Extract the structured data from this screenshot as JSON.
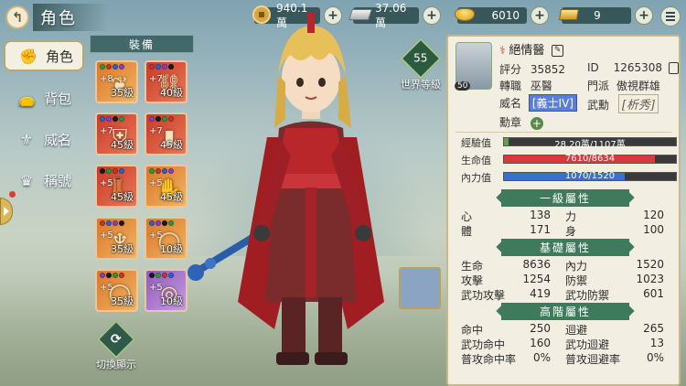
{
  "header": {
    "title": "角色",
    "resources": [
      {
        "icon": "copper-coin-icon",
        "value": "940.1萬"
      },
      {
        "icon": "silver-bar-icon",
        "value": "37.06萬"
      },
      {
        "icon": "gold-ingot-icon",
        "value": "6010"
      },
      {
        "icon": "gold-bar-icon",
        "value": "9"
      }
    ]
  },
  "nav": {
    "items": [
      {
        "label": "角色",
        "icon": "fist-icon",
        "active": true
      },
      {
        "label": "背包",
        "icon": "bag-icon",
        "active": false
      },
      {
        "label": "威名",
        "icon": "crest-icon",
        "active": false
      },
      {
        "label": "稱號",
        "icon": "title-badge-icon",
        "active": false
      }
    ]
  },
  "equipment": {
    "title": "裝備",
    "slots": [
      {
        "plus": "+8",
        "level": "35級",
        "rarity": "orange",
        "item": "necklace-icon"
      },
      {
        "plus": "+7",
        "level": "40級",
        "rarity": "red",
        "item": "wrist-guard-icon"
      },
      {
        "plus": "+7",
        "level": "45級",
        "rarity": "red",
        "item": "armor-icon"
      },
      {
        "plus": "+7",
        "level": "45級",
        "rarity": "red",
        "item": "bracer-icon"
      },
      {
        "plus": "+5",
        "level": "45級",
        "rarity": "red",
        "item": "boots-icon"
      },
      {
        "plus": "+5",
        "level": "45級",
        "rarity": "orange",
        "item": "gloves-icon"
      },
      {
        "plus": "+5",
        "level": "35級",
        "rarity": "orange",
        "item": "pendant-icon"
      },
      {
        "plus": "+5",
        "level": "10級",
        "rarity": "orange",
        "item": "ring-icon"
      },
      {
        "plus": "+5",
        "level": "35級",
        "rarity": "orange",
        "item": "ring-icon"
      },
      {
        "plus": "+5",
        "level": "10級",
        "rarity": "purple",
        "item": "jade-pendant-icon"
      }
    ],
    "swap_label": "切換顯示"
  },
  "world_level": {
    "value": "55",
    "label": "世界等級"
  },
  "profile": {
    "avatar_level": "50",
    "name": "絕情醫",
    "score_label": "評分",
    "score": "35852",
    "id_label": "ID",
    "id": "1265308",
    "job_label": "轉職",
    "job": "巫醫",
    "sect_label": "門派",
    "sect": "傲視群雄",
    "fame_label": "威名",
    "fame": "[義士IV]",
    "martial_label": "武勳",
    "martial": "[析秀]",
    "medal_label": "勳章"
  },
  "bars": [
    {
      "label": "經驗值",
      "text": "28.20萬/1107萬",
      "fraction": 0.025,
      "color": "#5ea04a"
    },
    {
      "label": "生命值",
      "text": "7610/8634",
      "fraction": 0.88,
      "color": "#d83a3a"
    },
    {
      "label": "內力值",
      "text": "1070/1520",
      "fraction": 0.7,
      "color": "#3a6fd0"
    }
  ],
  "sections": {
    "primary": {
      "title": "一級屬性",
      "stats": [
        [
          "心",
          "138",
          "力",
          "120"
        ],
        [
          "體",
          "171",
          "身",
          "100"
        ]
      ]
    },
    "base": {
      "title": "基礎屬性",
      "stats": [
        [
          "生命",
          "8636",
          "內力",
          "1520"
        ],
        [
          "攻擊",
          "1254",
          "防禦",
          "1023"
        ],
        [
          "武功攻擊",
          "419",
          "武功防禦",
          "601"
        ]
      ]
    },
    "advanced": {
      "title": "高階屬性",
      "stats": [
        [
          "命中",
          "250",
          "迴避",
          "265"
        ],
        [
          "武功命中",
          "160",
          "武功迴避",
          "13"
        ],
        [
          "普攻命中率",
          "0%",
          "普攻迴避率",
          "0%"
        ]
      ]
    }
  }
}
